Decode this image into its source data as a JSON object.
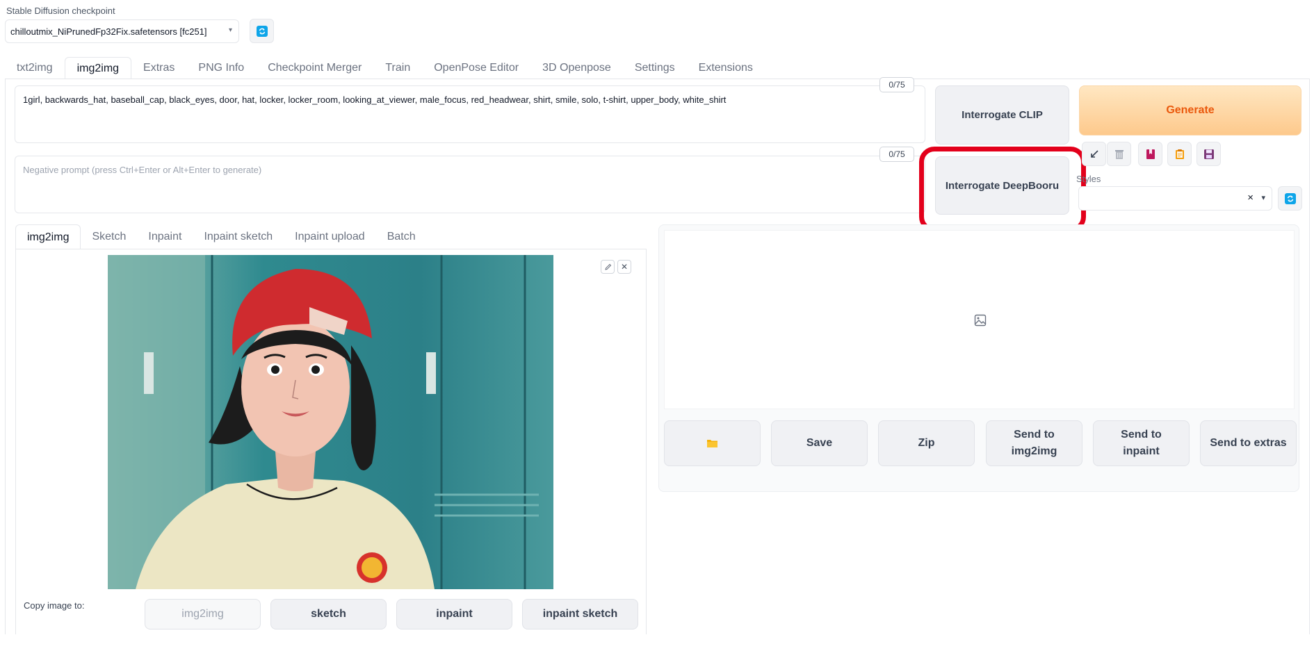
{
  "checkpoint": {
    "label": "Stable Diffusion checkpoint",
    "value": "chilloutmix_NiPrunedFp32Fix.safetensors [fc251]"
  },
  "main_tabs": [
    "txt2img",
    "img2img",
    "Extras",
    "PNG Info",
    "Checkpoint Merger",
    "Train",
    "OpenPose Editor",
    "3D Openpose",
    "Settings",
    "Extensions"
  ],
  "prompt": {
    "text": "1girl, backwards_hat, baseball_cap, black_eyes, door, hat, locker, locker_room, looking_at_viewer, male_focus, red_headwear, shirt, smile, solo, t-shirt, upper_body, white_shirt",
    "counter": "0/75"
  },
  "negative_prompt": {
    "placeholder": "Negative prompt (press Ctrl+Enter or Alt+Enter to generate)",
    "counter": "0/75"
  },
  "buttons": {
    "interrogate_clip": "Interrogate CLIP",
    "interrogate_deepbooru": "Interrogate DeepBooru",
    "generate": "Generate"
  },
  "styles": {
    "label": "Styles"
  },
  "sub_tabs": [
    "img2img",
    "Sketch",
    "Inpaint",
    "Inpaint sketch",
    "Inpaint upload",
    "Batch"
  ],
  "copy_image": {
    "label": "Copy image to:",
    "buttons": [
      "img2img",
      "sketch",
      "inpaint",
      "inpaint sketch"
    ]
  },
  "output_buttons": {
    "save": "Save",
    "zip": "Zip",
    "send_img2img_1": "Send to",
    "send_img2img_2": "img2img",
    "send_inpaint_1": "Send to",
    "send_inpaint_2": "inpaint",
    "send_extras": "Send to extras"
  },
  "colors": {
    "highlight": "#e3001b",
    "generate_text": "#ea580c",
    "refresh_icon": "#0ea5e9"
  },
  "icons": [
    "refresh-icon",
    "arrow-icon",
    "trash-icon",
    "bookmark-icon",
    "clipboard-icon",
    "save-icon",
    "folder-icon",
    "image-placeholder-icon",
    "edit-icon",
    "close-icon"
  ]
}
